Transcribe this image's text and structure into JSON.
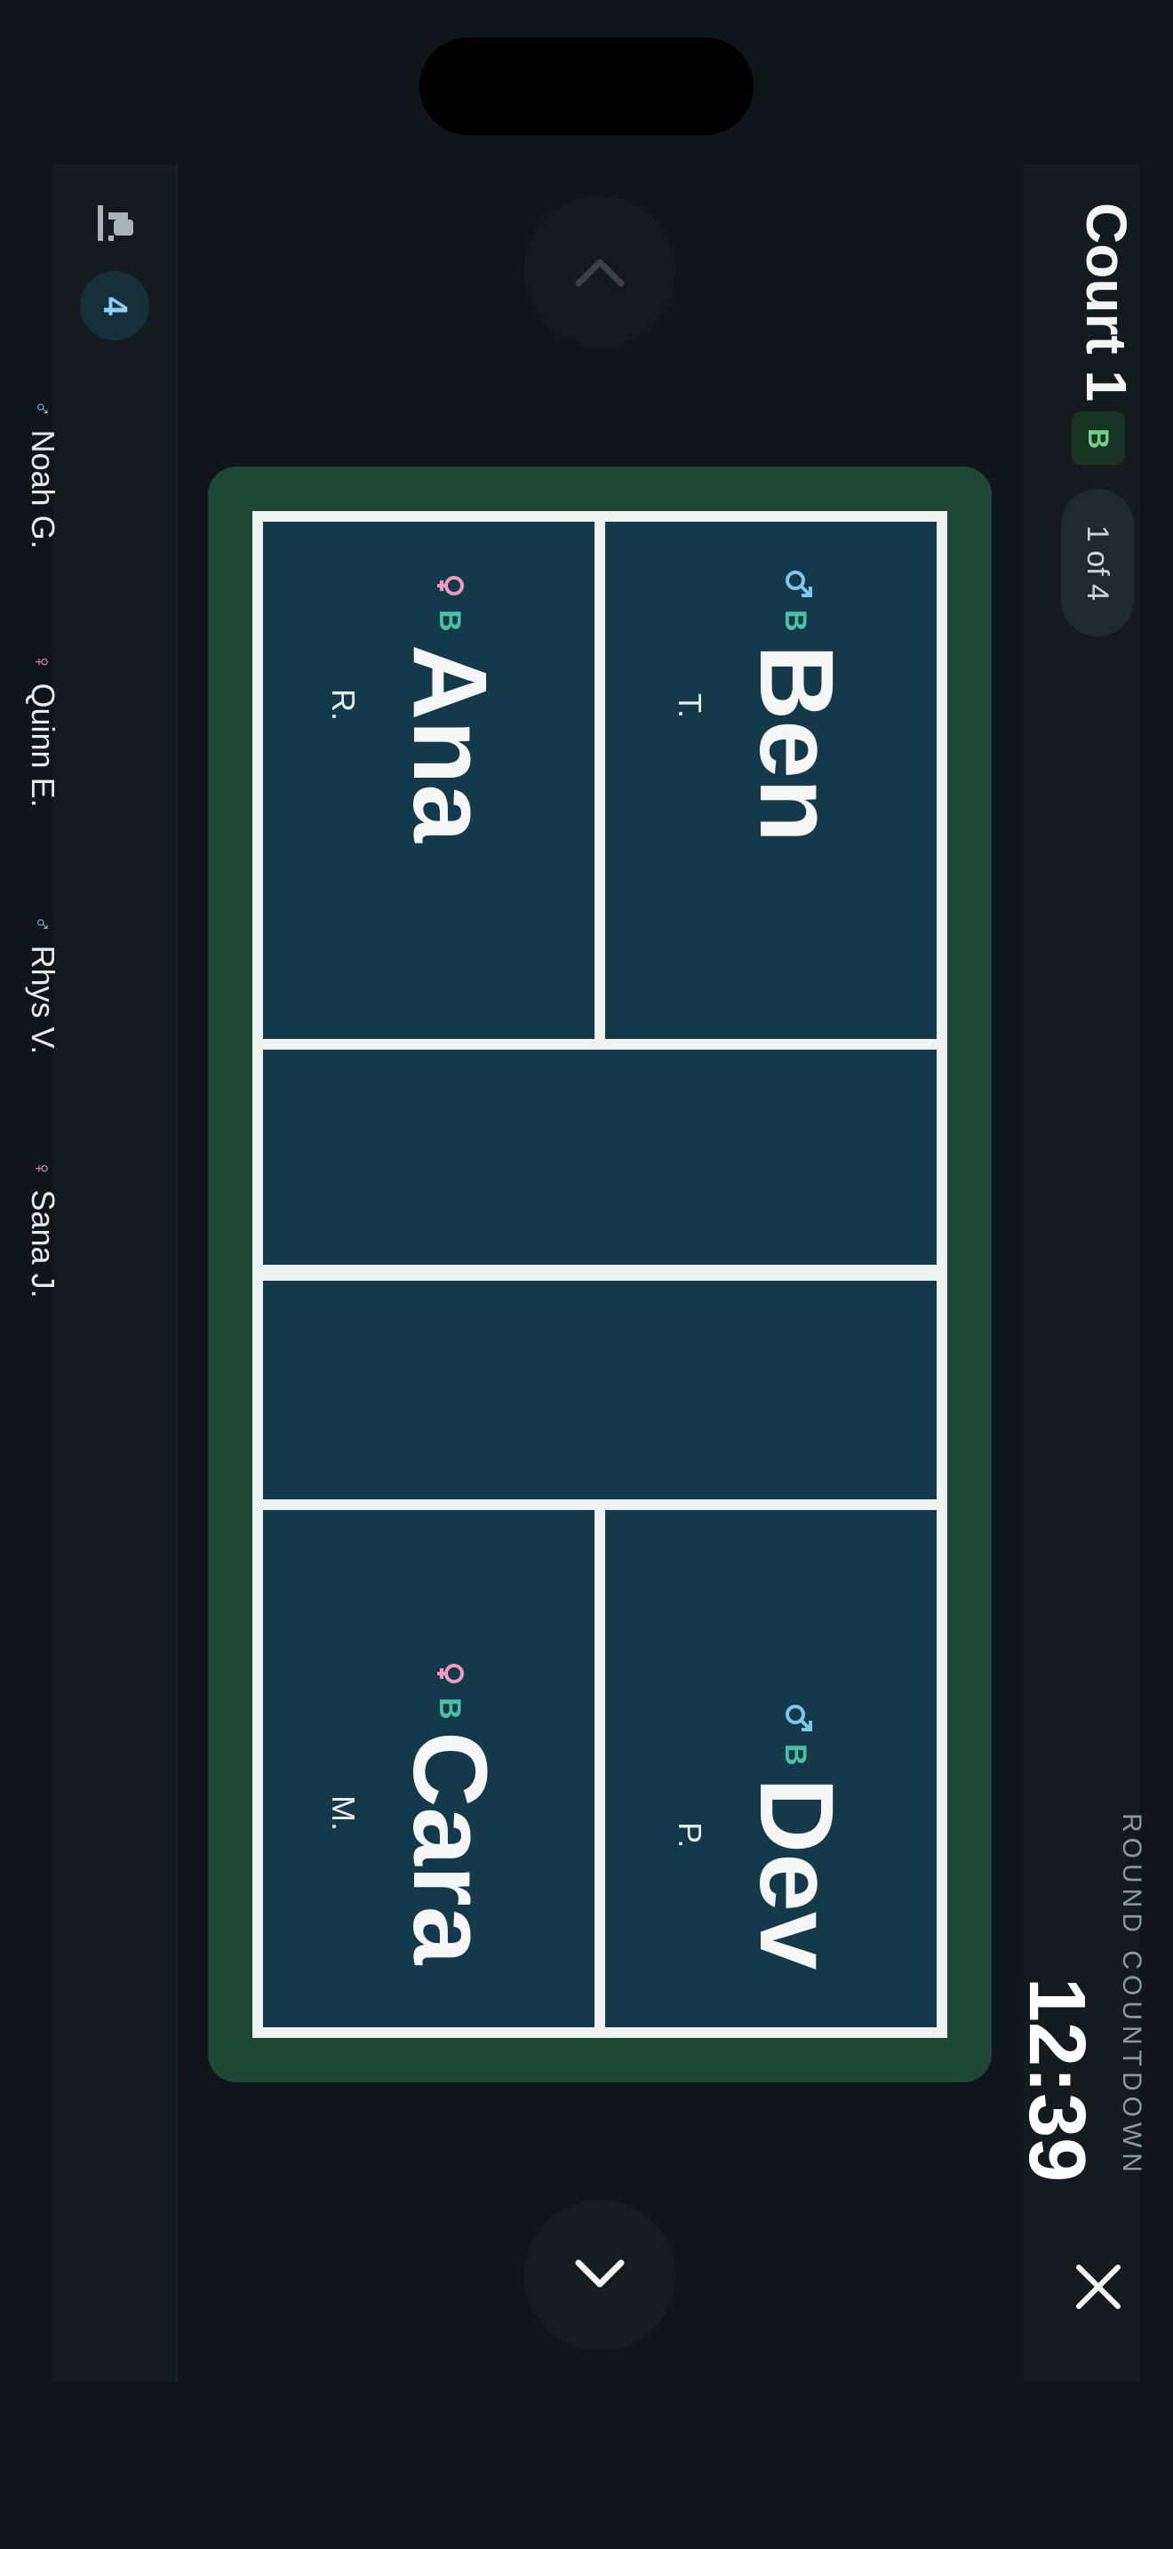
{
  "bench": {
    "count": "4",
    "icon": "bench-seat-icon",
    "players": [
      {
        "name": "Noah G.",
        "gender": "male"
      },
      {
        "name": "Quinn E.",
        "gender": "female"
      },
      {
        "name": "Rhys V.",
        "gender": "male"
      },
      {
        "name": "Sana J.",
        "gender": "female"
      }
    ]
  },
  "header": {
    "title": "Court 1",
    "tier": "B",
    "page": "1 of 4",
    "countdown_label": "ROUND COUNTDOWN",
    "countdown": "12:39"
  },
  "court": {
    "players": [
      {
        "first": "Ben",
        "last": "T.",
        "tier": "B",
        "gender": "male"
      },
      {
        "first": "Ana",
        "last": "R.",
        "tier": "B",
        "gender": "female"
      },
      {
        "first": "Dev",
        "last": "P.",
        "tier": "B",
        "gender": "male"
      },
      {
        "first": "Cara",
        "last": "M.",
        "tier": "B",
        "gender": "female"
      }
    ]
  },
  "colors": {
    "background": "#0f1518",
    "court_surface": "#14394a",
    "court_surround": "#1e4736",
    "male": "#7dc6ee",
    "female": "#f29ab7",
    "tier": "#4cc0a2"
  }
}
